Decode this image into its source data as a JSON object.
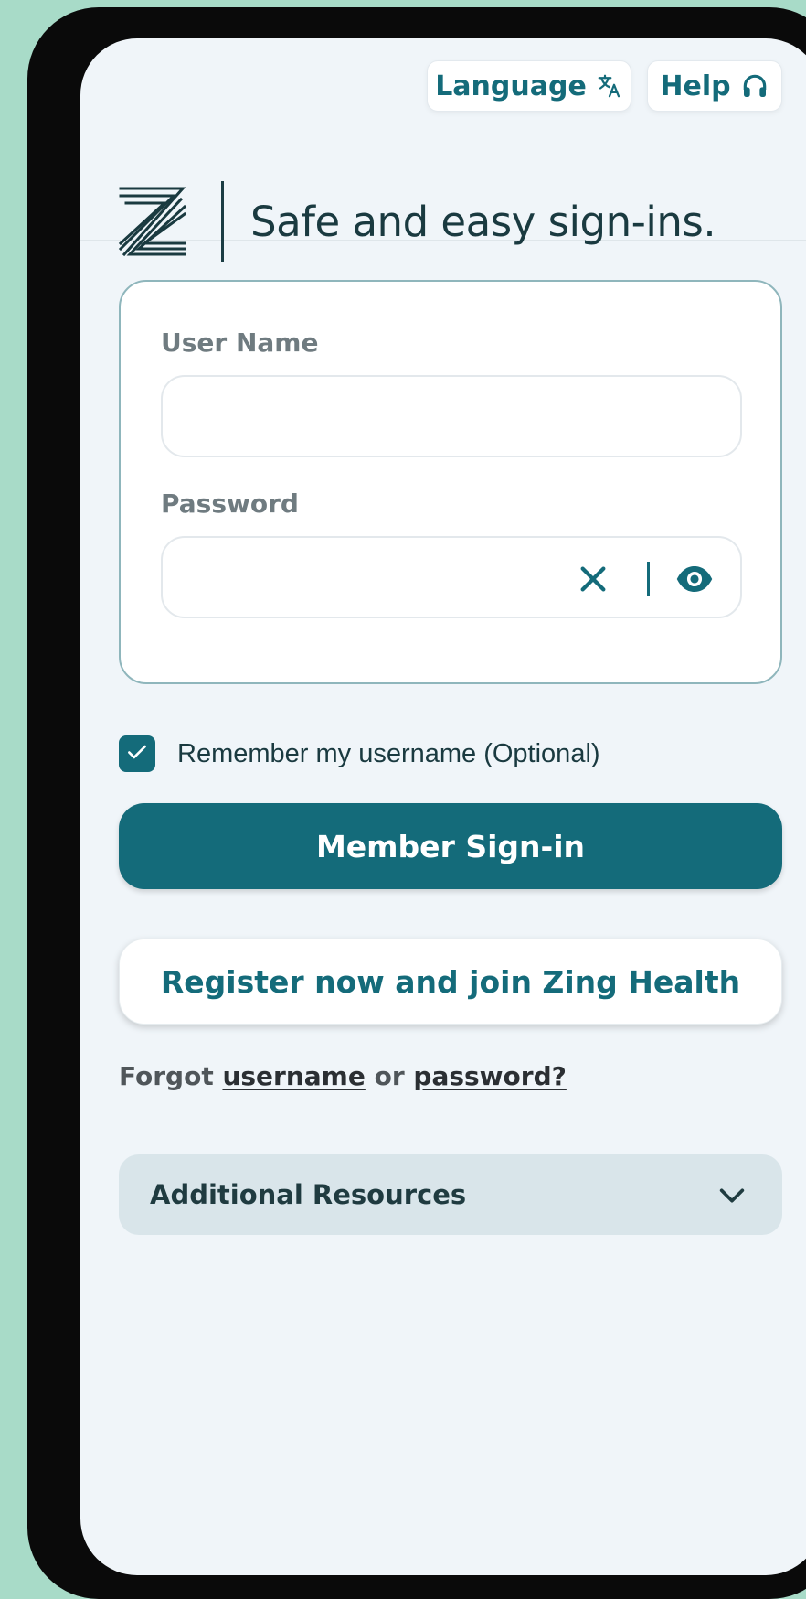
{
  "colors": {
    "accent": "#146b7a",
    "page_background": "#f0f5f9",
    "outer_background": "#a8dbc8",
    "resources_background": "#d9e5ea"
  },
  "topbar": {
    "language_label": "Language",
    "language_icon": "translate-icon",
    "help_label": "Help",
    "help_icon": "headset-icon"
  },
  "brand": {
    "logo": "zing-logo-icon",
    "tagline": "Safe and easy sign-ins."
  },
  "form": {
    "username_label": "User Name",
    "username_value": "",
    "password_label": "Password",
    "password_value": "",
    "clear_icon": "close-icon",
    "reveal_icon": "eye-icon"
  },
  "remember": {
    "checked": true,
    "label": "Remember my username (Optional)"
  },
  "actions": {
    "sign_in_label": "Member Sign-in",
    "register_label": "Register now and join Zing Health"
  },
  "forgot": {
    "prefix": "Forgot",
    "username_link": "username",
    "conjunction": "or",
    "password_link": "password?"
  },
  "resources": {
    "label": "Additional Resources",
    "icon": "chevron-down-icon"
  }
}
